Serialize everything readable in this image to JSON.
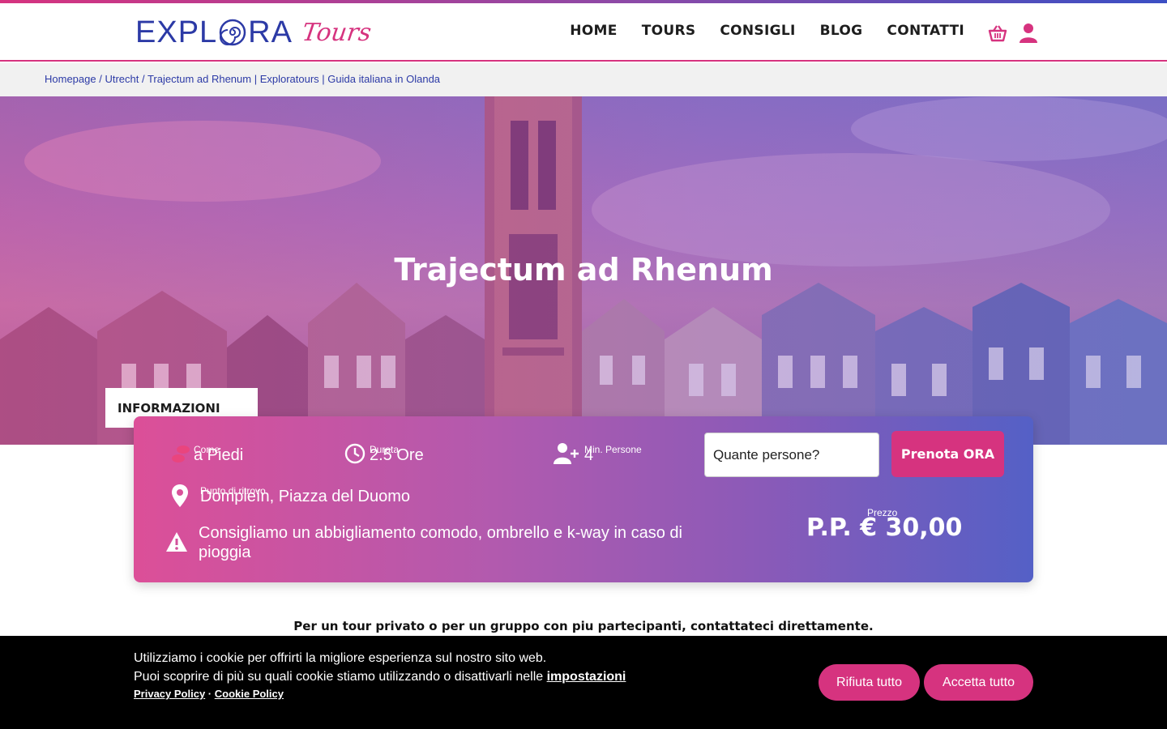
{
  "header": {
    "logo_main": "EXPL",
    "logo_main_end": "RA",
    "logo_script": "Tours",
    "nav": [
      "HOME",
      "TOURS",
      "CONSIGLI",
      "BLOG",
      "CONTATTI"
    ],
    "icons": [
      "cart-icon",
      "user-icon"
    ]
  },
  "breadcrumb": {
    "items": [
      "Homepage",
      "Utrecht",
      "Trajectum ad Rhenum | Exploratours | Guida italiana in Olanda"
    ],
    "separator": " / "
  },
  "hero": {
    "title": "Trajectum ad Rhenum"
  },
  "info": {
    "tab_label": "INFORMAZIONI",
    "come_label": "Come",
    "come_value": "a Piedi",
    "durata_label": "Durata",
    "durata_value": "2.5 Ore",
    "min_label": "Min. Persone",
    "min_value": "4",
    "ritrovo_label": "Punto di ritrovo",
    "ritrovo_value": "Dompleín, Piazza del Duomo",
    "warning_line1": "Consigliamo un abbigliamento comodo, ombrello e k-way in caso di",
    "warning_line2": "pioggia",
    "qty_placeholder": "Quante persone?",
    "book_label": "Prenota ORA",
    "price_label": "Prezzo",
    "price_value": "P.P. € 30,00"
  },
  "private_note": "Per un tour privato o per un gruppo con piu partecipanti, contattateci direttamente.",
  "cookie": {
    "line1": "Utilizziamo i cookie per offrirti la migliore esperienza sul nostro sito web.",
    "line2": "Puoi scoprire di più su quali cookie stiamo utilizzando o disattivarli nelle ",
    "settings_link": "impostazioni",
    "privacy_link": "Privacy Policy",
    "link_sep": " · ",
    "cookie_link": "Cookie Policy",
    "reject_label": "Rifiuta tutto",
    "accept_label": "Accetta tutto"
  },
  "colors": {
    "brand_pink": "#d6337f",
    "brand_blue": "#2c3aa6"
  }
}
